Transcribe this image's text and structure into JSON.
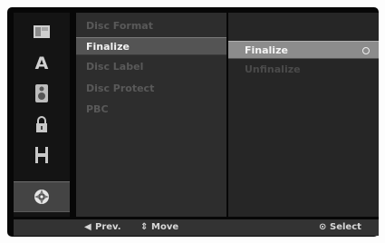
{
  "sidebar": {
    "icons": [
      "disc-icon",
      "language-icon",
      "audio-speaker-icon",
      "lock-icon",
      "film-record-icon",
      "disc-settings-icon"
    ],
    "active_index": 5
  },
  "menu": {
    "items": [
      {
        "label": "Disc Format"
      },
      {
        "label": "Finalize"
      },
      {
        "label": "Disc Label"
      },
      {
        "label": "Disc Protect"
      },
      {
        "label": "PBC"
      }
    ],
    "selected_index": 1
  },
  "submenu": {
    "items": [
      {
        "label": "Finalize"
      },
      {
        "label": "Unfinalize"
      }
    ],
    "selected_index": 0
  },
  "footer": {
    "prev": "Prev.",
    "move": "Move",
    "select": "Select"
  }
}
